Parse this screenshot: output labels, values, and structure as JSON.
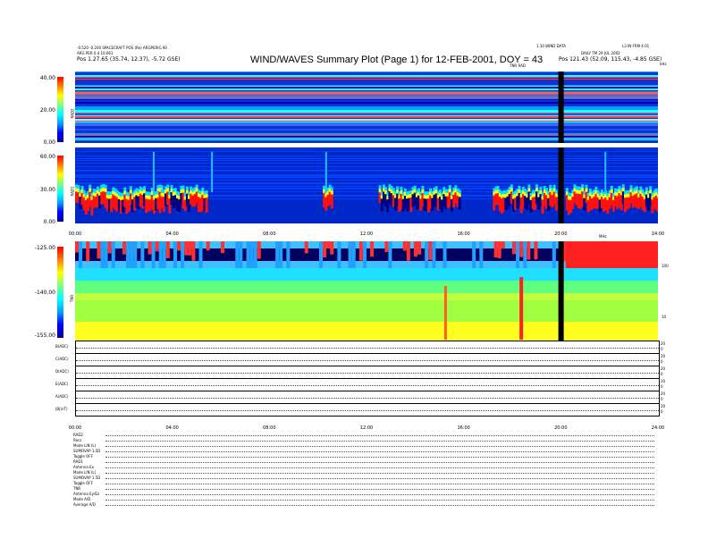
{
  "header": {
    "title": "WIND/WAVES Summary Plot (Page 1) for 12-FEB-2001, DOY = 43",
    "left_line1": "-0.520 -0.200 SPACECRAFT POS (Re) ARGPERIG 90",
    "left_line2": "ARG PER 0.4 10.061",
    "left_pos": "Pos  1.27.65 (35.74, 12.37), -5.72 GSE)",
    "right_small": "1.10 WIND DATA",
    "right_tag": "L3 IN FRM 4.01",
    "right_line2": "DAILY TM 29 JUL 2002",
    "right_pos": "Pos  121.43 (52.09, 115.43, -4.85 GSE)",
    "tnr_tag": "TNR RAD",
    "khz_unit": "kHz",
    "mhz_unit": "MHz"
  },
  "panels": {
    "rad2": {
      "label": "RAD2",
      "yticks": [
        "40.00",
        "20.00",
        "0.00"
      ]
    },
    "rad1": {
      "label": "RAD1",
      "yticks": [
        "60.00",
        "30.00",
        "0.00"
      ]
    },
    "tnr": {
      "label": "TNR",
      "yticks": [
        "-125.00",
        "-140.00",
        "-155.00"
      ],
      "right_ticks": [
        "100",
        "10"
      ]
    }
  },
  "chart_data": {
    "type": "heatmap",
    "title": "WIND/WAVES Summary Plot (Page 1) for 12-FEB-2001, DOY = 43",
    "x": [
      "00:00",
      "04:00",
      "08:00",
      "12:00",
      "16:00",
      "20:00",
      "24:00"
    ],
    "xlim": [
      0,
      24
    ],
    "data_gap_hour": 19.9,
    "series": [
      {
        "name": "RAD2",
        "ylim": [
          0,
          40
        ]
      },
      {
        "name": "RAD1",
        "ylim": [
          0,
          60
        ]
      },
      {
        "name": "TNR",
        "ylim": [
          -155,
          -125
        ]
      }
    ]
  },
  "strips": [
    {
      "label": "B(ADC)",
      "r1": "20",
      "r2": "0"
    },
    {
      "label": "C(ADC)",
      "r1": "20",
      "r2": "0"
    },
    {
      "label": "D(ADC)",
      "r1": "20",
      "r2": "0"
    },
    {
      "label": "E(ADC)",
      "r1": "20",
      "r2": "0"
    },
    {
      "label": "A(ADC)",
      "r1": "20",
      "r2": "0"
    },
    {
      "label": "|B|(nT)",
      "r1": "20",
      "r2": "0"
    }
  ],
  "strip_xticks": [
    "00:00",
    "04:00",
    "08:00",
    "12:00",
    "16:00",
    "20:00",
    "24:00"
  ],
  "receiver_block": [
    {
      "name": "RAD2",
      "rows": [
        "Recs",
        "Mode  LIN (L)",
        "SUMOVAP 1.5D",
        "Toggle  OFF"
      ]
    },
    {
      "name": "RAD1",
      "rows": [
        "Antenna  Ex",
        "Mode  LIN (L)",
        "SUMOVAP 1.5D",
        "Toggle  OFF"
      ]
    },
    {
      "name": "TNR",
      "rows": [
        "Antenna  Ey/Ez",
        "Mode  A/D",
        "Average  A/D"
      ]
    }
  ]
}
